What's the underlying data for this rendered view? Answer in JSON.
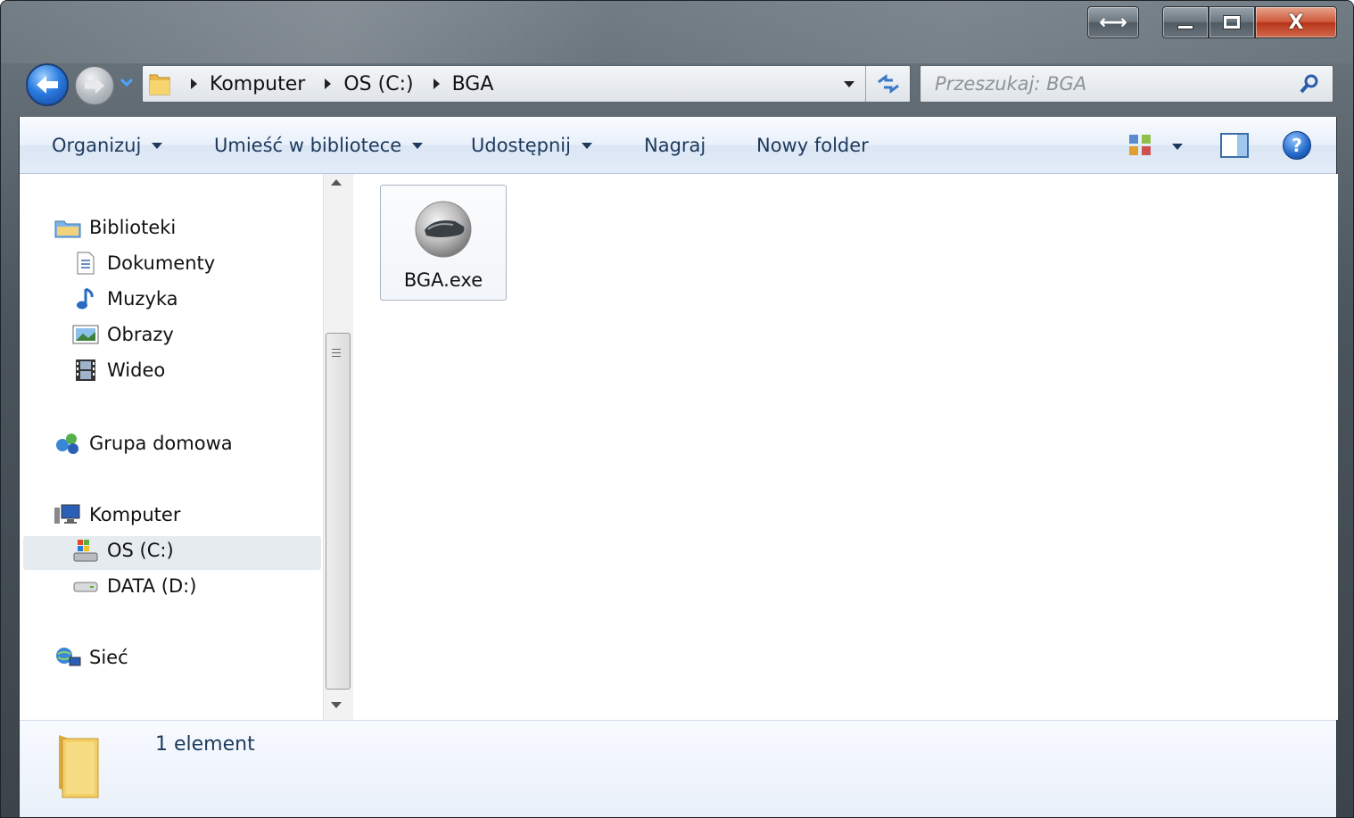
{
  "titlebar": {
    "snap_label": "⟷",
    "min_label": "–",
    "max_label": "□",
    "close_label": "X"
  },
  "address": {
    "breadcrumbs": [
      "Komputer",
      "OS (C:)",
      "BGA"
    ]
  },
  "search": {
    "placeholder": "Przeszukaj: BGA"
  },
  "toolbar": {
    "organize": "Organizuj",
    "library": "Umieść w bibliotece",
    "share": "Udostępnij",
    "burn": "Nagraj",
    "new_folder": "Nowy folder",
    "help": "?"
  },
  "sidebar": {
    "libraries": "Biblioteki",
    "documents": "Dokumenty",
    "music": "Muzyka",
    "pictures": "Obrazy",
    "videos": "Wideo",
    "homegroup": "Grupa domowa",
    "computer": "Komputer",
    "drive_c": "OS (C:)",
    "drive_d": "DATA (D:)",
    "network": "Sieć"
  },
  "files": [
    {
      "name": "BGA.exe"
    }
  ],
  "status": {
    "count": "1 element"
  }
}
